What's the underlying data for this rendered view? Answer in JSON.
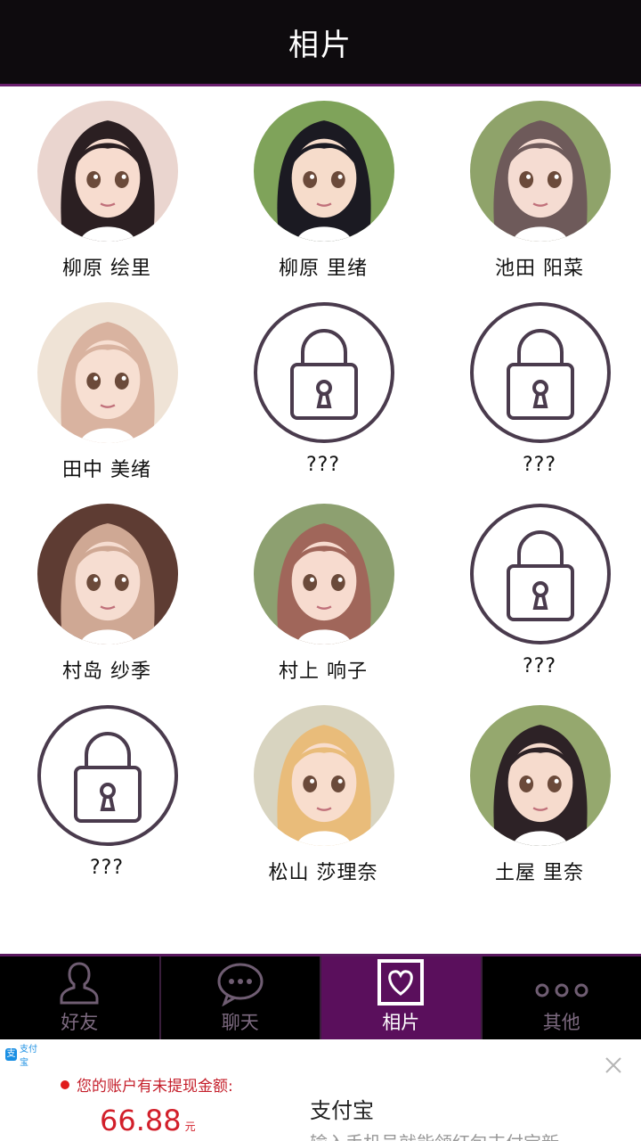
{
  "header": {
    "title": "相片"
  },
  "gallery": [
    {
      "name": "柳原 绘里",
      "locked": false,
      "hair": "#2b1f22",
      "skin": "#f7dccf",
      "bg": "#ead5cf"
    },
    {
      "name": "柳原 里绪",
      "locked": false,
      "hair": "#1b1a22",
      "skin": "#f6dccb",
      "bg": "#7fa35a"
    },
    {
      "name": "池田 阳菜",
      "locked": false,
      "hair": "#6e5a5a",
      "skin": "#f5dcd2",
      "bg": "#8fa36a"
    },
    {
      "name": "田中 美绪",
      "locked": false,
      "hair": "#d9b3a0",
      "skin": "#f7dfd2",
      "bg": "#efe3d6"
    },
    {
      "name": "???",
      "locked": true
    },
    {
      "name": "???",
      "locked": true
    },
    {
      "name": "村岛 纱季",
      "locked": false,
      "hair": "#cfa894",
      "skin": "#f6ddd1",
      "bg": "#5e3c33"
    },
    {
      "name": "村上 响子",
      "locked": false,
      "hair": "#a0665a",
      "skin": "#f7dbcf",
      "bg": "#8da070"
    },
    {
      "name": "???",
      "locked": true
    },
    {
      "name": "???",
      "locked": true
    },
    {
      "name": "松山 莎理奈",
      "locked": false,
      "hair": "#e9bc7a",
      "skin": "#f8ddcd",
      "bg": "#d8d4c0"
    },
    {
      "name": "土屋 里奈",
      "locked": false,
      "hair": "#2d2226",
      "skin": "#f6dbcd",
      "bg": "#95a86e"
    }
  ],
  "tabs": [
    {
      "label": "好友",
      "icon": "person-icon",
      "active": false
    },
    {
      "label": "聊天",
      "icon": "chat-bubble-icon",
      "active": false
    },
    {
      "label": "相片",
      "icon": "heart-photo-icon",
      "active": true
    },
    {
      "label": "其他",
      "icon": "more-dots-icon",
      "active": false
    }
  ],
  "ad": {
    "logo_text": "支付宝",
    "alert": "您的账户有未提现金额:",
    "amount": "66.88",
    "unit": "元",
    "brand": "支付宝",
    "subtitle": "输入手机号就能领红包支付宝新"
  },
  "colors": {
    "accent": "#5a0f5c",
    "header_bg": "#0e0b0e",
    "lock_stroke": "#4a3b4d"
  }
}
